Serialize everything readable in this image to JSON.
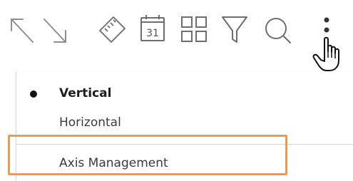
{
  "toolbar": {
    "icons": [
      "arrow-up-left-icon",
      "arrow-down-right-icon",
      "ruler-icon",
      "calendar-icon",
      "grid-icon",
      "filter-icon",
      "search-icon",
      "more-vertical-icon"
    ],
    "calendar_day": "31"
  },
  "menu": {
    "items": [
      {
        "label": "Vertical",
        "selected": true
      },
      {
        "label": "Horizontal",
        "selected": false
      },
      {
        "label": "Axis Management",
        "selected": false
      }
    ]
  },
  "colors": {
    "icon_gray": "#8a8a8a",
    "highlight_orange": "#ee9a4d",
    "text": "#3a3a3a"
  }
}
